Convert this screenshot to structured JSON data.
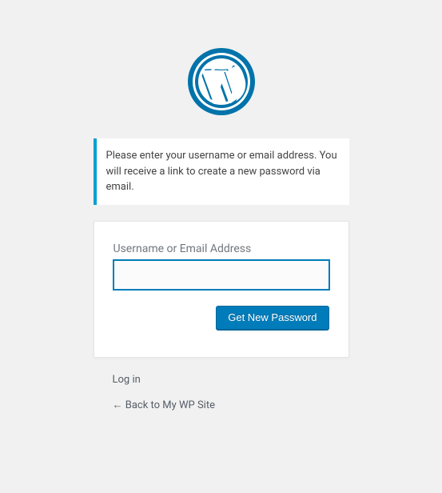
{
  "message": "Please enter your username or email address. You will receive a link to create a new password via email.",
  "form": {
    "label": "Username or Email Address",
    "input_value": "",
    "submit_label": "Get New Password"
  },
  "nav": {
    "login_link": "Log in",
    "back_link": "← Back to My WP Site"
  }
}
